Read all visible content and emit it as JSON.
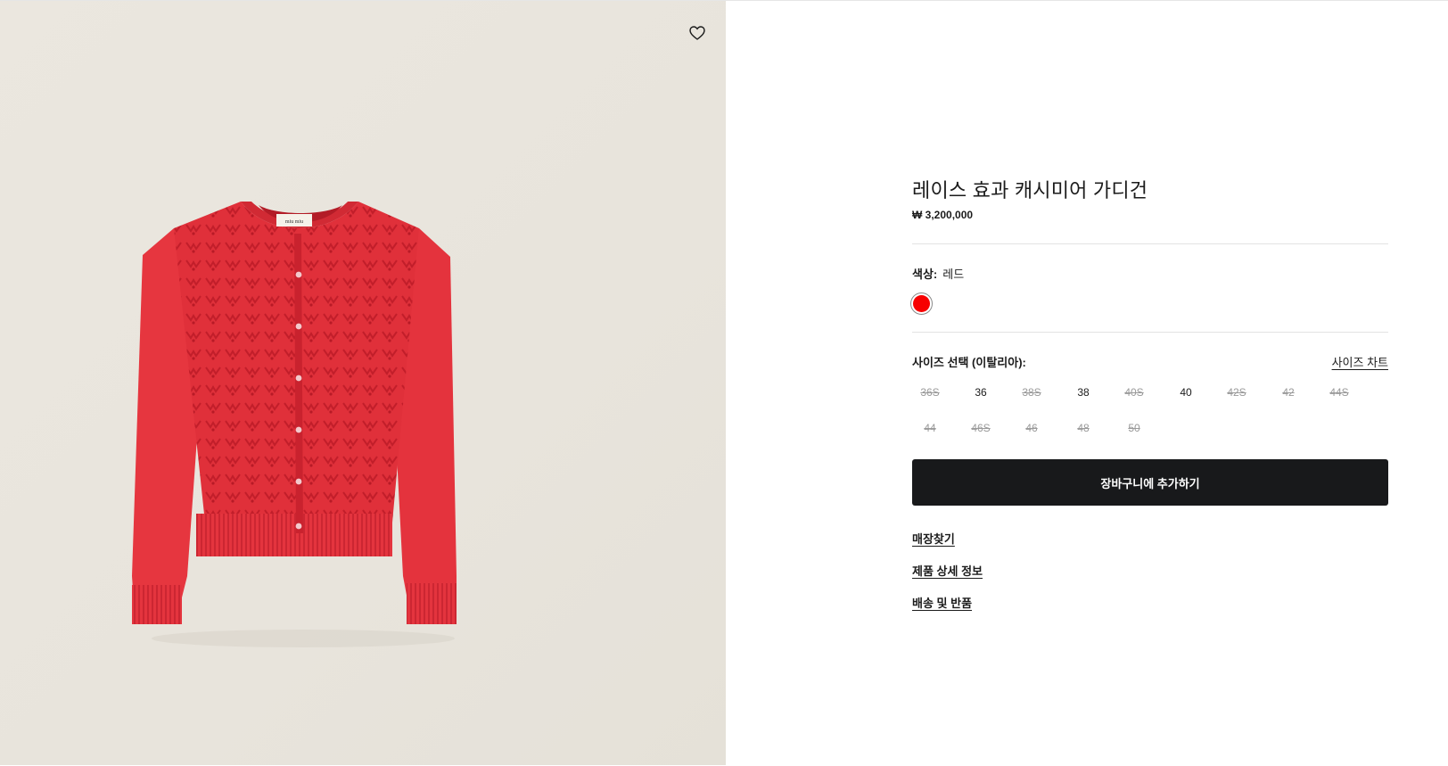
{
  "product": {
    "title": "레이스 효과 캐시미어 가디건",
    "price": "₩ 3,200,000",
    "label_brand": "miu miu",
    "image_desc": "red-cardigan-image"
  },
  "color": {
    "label": "색상:",
    "value": "레드",
    "swatch_hex": "#f70000"
  },
  "size": {
    "label": "사이즈 선택 (이탈리아):",
    "chart_link": "사이즈 차트",
    "options": [
      {
        "label": "36S",
        "available": false
      },
      {
        "label": "36",
        "available": true
      },
      {
        "label": "38S",
        "available": false
      },
      {
        "label": "38",
        "available": true
      },
      {
        "label": "40S",
        "available": false
      },
      {
        "label": "40",
        "available": true
      },
      {
        "label": "42S",
        "available": false
      },
      {
        "label": "42",
        "available": false
      },
      {
        "label": "44S",
        "available": false
      },
      {
        "label": "44",
        "available": false
      },
      {
        "label": "46S",
        "available": false
      },
      {
        "label": "46",
        "available": false
      },
      {
        "label": "48",
        "available": false
      },
      {
        "label": "50",
        "available": false
      }
    ]
  },
  "actions": {
    "add_to_cart": "장바구니에 추가하기"
  },
  "links": {
    "find_store": "매장찾기",
    "product_details": "제품 상세 정보",
    "shipping_returns": "배송 및 반품"
  },
  "colors": {
    "button_bg": "#18191b",
    "image_bg": "#e9e5dd",
    "garment": "#e8343c"
  }
}
